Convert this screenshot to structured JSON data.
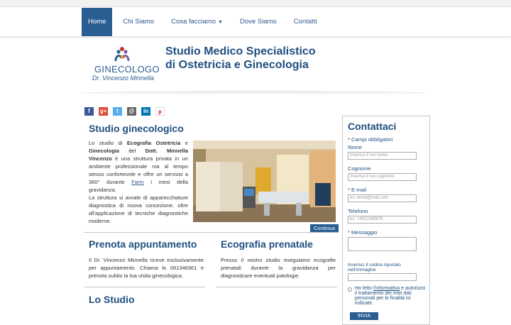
{
  "nav": {
    "items": [
      {
        "label": "Home"
      },
      {
        "label": "Chi Siamo"
      },
      {
        "label": "Cosa facciamo"
      },
      {
        "label": "Dove Siamo"
      },
      {
        "label": "Contatti"
      }
    ]
  },
  "logo": {
    "line1": "GINECOLOGO",
    "line2": "Dr. Vincenzo Minnella"
  },
  "site_title": {
    "line1": "Studio Medico Specialistico",
    "line2": "di Ostetricia e Ginecologia"
  },
  "social": {
    "facebook": "f",
    "gplus": "g+",
    "twitter": "t",
    "email": "@",
    "linkedin": "in",
    "pinterest": "p"
  },
  "intro": {
    "title": "Studio ginecologico",
    "p1a": "Lo studio di ",
    "p1b": "Ecografia Ostetricia",
    "p1c": " e ",
    "p1d": "Ginecologia",
    "p1e": " del ",
    "p1f": "Dott. Minnella Vincenzo",
    "p1g": " è una struttura privata in un ambiente professionale ma al tempo stesso confortevole e offre un servizio a 360° durante ",
    "p1h": "Farm",
    "p1i": " i mesi della gravidanza.",
    "p2": "La struttura si avvale di apparecchiature diagnostica di nuova concezione, oltre all'applicazione di tecniche diagnostiche moderne.",
    "continue": "Continua"
  },
  "prenota": {
    "title": "Prenota appuntamento",
    "text": "Il Dr. Vincenzo Minnella riceve esclusivamente per appuntamento. Chiama lo 091346361 e prenota subito la tua visita ginecologica."
  },
  "ecografia": {
    "title": "Ecografia prenatale",
    "text": "Presso il nostro studio eseguiamo ecografie prenatali durante la gravidanza per diagnosticare eventuali patologie."
  },
  "studio": {
    "title": "Lo Studio"
  },
  "contact": {
    "title": "Contattaci",
    "required_note": "* Campi obbligatori",
    "name_label": "Nome",
    "name_placeholder": "Inserisci il tuo nome",
    "surname_label": "Cognome",
    "surname_placeholder": "Inserisci il tuo cognome",
    "email_label": "* E-mail",
    "email_placeholder": "es: email@mail.com",
    "phone_label": "Telefono",
    "phone_placeholder": "es: +3912345678",
    "message_label": "* Messaggio",
    "captcha_label": "Inserisci il codice riportato nell'immagine",
    "privacy_a": "Ho letto ",
    "privacy_link": "l'informativa",
    "privacy_b": " e autorizzo il trattamento dei miei dati personali per le finalità ivi indicate.",
    "send": "INVIA"
  },
  "colors": {
    "brand": "#2a5d92",
    "title": "#1e4f7f"
  }
}
